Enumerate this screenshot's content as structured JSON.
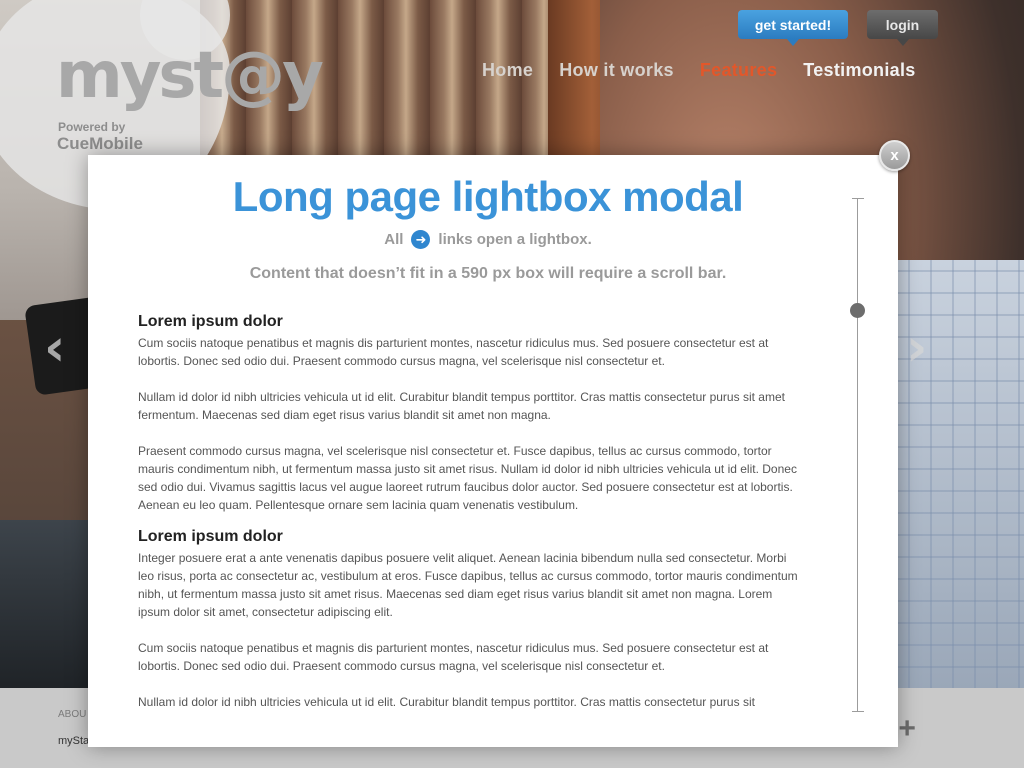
{
  "header": {
    "logo_text": "myst@y",
    "powered_by": "Powered by",
    "powered_brand": "CueMobile",
    "get_started_label": "get started!",
    "login_label": "login"
  },
  "nav": {
    "items": [
      {
        "label": "Home"
      },
      {
        "label": "How it works"
      },
      {
        "label": "Features"
      },
      {
        "label": "Testimonials"
      }
    ],
    "active": "Features"
  },
  "carousel": {
    "prev_icon": "‹",
    "next_icon": "›"
  },
  "modal": {
    "close_label": "x",
    "title": "Long page lightbox modal",
    "sub_line_prefix": "All",
    "sub_line_suffix": "links open a lightbox.",
    "link_icon": "➜",
    "sub_line2": "Content that doesn’t fit in a 590 px box will require a scroll bar.",
    "sections": [
      {
        "heading": "Lorem ipsum dolor",
        "paragraphs": [
          "Cum sociis natoque penatibus et magnis dis parturient montes, nascetur ridiculus mus. Sed posuere consectetur est at lobortis. Donec sed odio dui. Praesent commodo cursus magna, vel scelerisque nisl consectetur et.",
          "Nullam id dolor id nibh ultricies vehicula ut id elit. Curabitur blandit tempus porttitor. Cras mattis consectetur purus sit amet fermentum. Maecenas sed diam eget risus varius blandit sit amet non magna.",
          "Praesent commodo cursus magna, vel scelerisque nisl consectetur et. Fusce dapibus, tellus ac cursus commodo, tortor mauris condimentum nibh, ut fermentum massa justo sit amet risus. Nullam id dolor id nibh ultricies vehicula ut id elit. Donec sed odio dui. Vivamus sagittis lacus vel augue laoreet rutrum faucibus dolor auctor. Sed posuere consectetur est at lobortis. Aenean eu leo quam. Pellentesque ornare sem lacinia quam venenatis vestibulum."
        ]
      },
      {
        "heading": "Lorem ipsum dolor",
        "paragraphs": [
          "Integer posuere erat a ante venenatis dapibus posuere velit aliquet. Aenean lacinia bibendum nulla sed consectetur. Morbi leo risus, porta ac consectetur ac, vestibulum at eros. Fusce dapibus, tellus ac cursus commodo, tortor mauris condimentum nibh, ut fermentum massa justo sit amet risus. Maecenas sed diam eget risus varius blandit sit amet non magna. Lorem ipsum dolor sit amet, consectetur adipiscing elit.",
          "Cum sociis natoque penatibus et magnis dis parturient montes, nascetur ridiculus mus. Sed posuere consectetur est at lobortis. Donec sed odio dui. Praesent commodo cursus magna, vel scelerisque nisl consectetur et.",
          "Nullam id dolor id nibh ultricies vehicula ut id elit. Curabitur blandit tempus porttitor. Cras mattis consectetur purus sit"
        ]
      }
    ]
  },
  "footer": {
    "about_label": "ABOU",
    "mystay_label": "mySta",
    "plus_label": "n+"
  },
  "colors": {
    "accent_blue": "#3b93d8",
    "nav_active": "#e2572a"
  }
}
